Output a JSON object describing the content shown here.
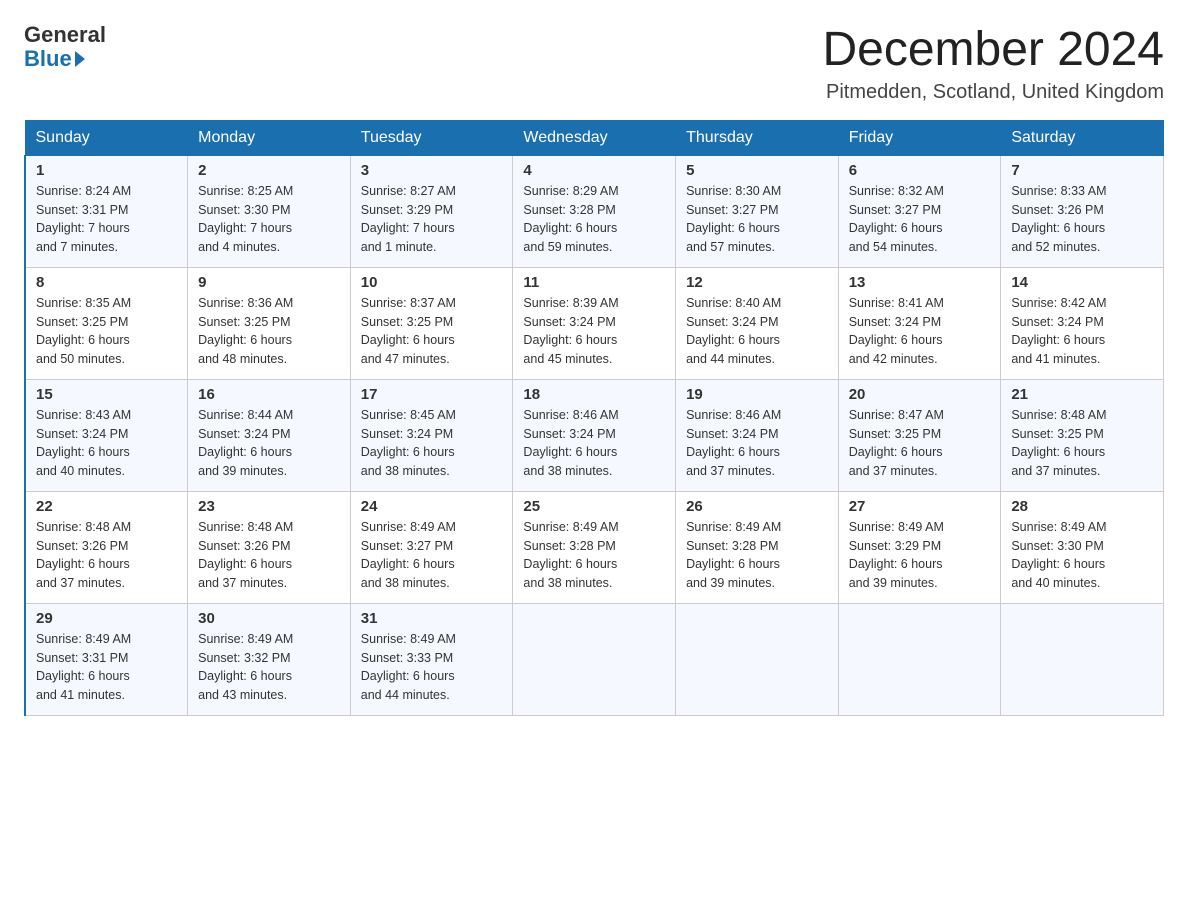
{
  "logo": {
    "general": "General",
    "blue": "Blue"
  },
  "title": "December 2024",
  "location": "Pitmedden, Scotland, United Kingdom",
  "days_of_week": [
    "Sunday",
    "Monday",
    "Tuesday",
    "Wednesday",
    "Thursday",
    "Friday",
    "Saturday"
  ],
  "weeks": [
    [
      {
        "day": "1",
        "info": "Sunrise: 8:24 AM\nSunset: 3:31 PM\nDaylight: 7 hours\nand 7 minutes."
      },
      {
        "day": "2",
        "info": "Sunrise: 8:25 AM\nSunset: 3:30 PM\nDaylight: 7 hours\nand 4 minutes."
      },
      {
        "day": "3",
        "info": "Sunrise: 8:27 AM\nSunset: 3:29 PM\nDaylight: 7 hours\nand 1 minute."
      },
      {
        "day": "4",
        "info": "Sunrise: 8:29 AM\nSunset: 3:28 PM\nDaylight: 6 hours\nand 59 minutes."
      },
      {
        "day": "5",
        "info": "Sunrise: 8:30 AM\nSunset: 3:27 PM\nDaylight: 6 hours\nand 57 minutes."
      },
      {
        "day": "6",
        "info": "Sunrise: 8:32 AM\nSunset: 3:27 PM\nDaylight: 6 hours\nand 54 minutes."
      },
      {
        "day": "7",
        "info": "Sunrise: 8:33 AM\nSunset: 3:26 PM\nDaylight: 6 hours\nand 52 minutes."
      }
    ],
    [
      {
        "day": "8",
        "info": "Sunrise: 8:35 AM\nSunset: 3:25 PM\nDaylight: 6 hours\nand 50 minutes."
      },
      {
        "day": "9",
        "info": "Sunrise: 8:36 AM\nSunset: 3:25 PM\nDaylight: 6 hours\nand 48 minutes."
      },
      {
        "day": "10",
        "info": "Sunrise: 8:37 AM\nSunset: 3:25 PM\nDaylight: 6 hours\nand 47 minutes."
      },
      {
        "day": "11",
        "info": "Sunrise: 8:39 AM\nSunset: 3:24 PM\nDaylight: 6 hours\nand 45 minutes."
      },
      {
        "day": "12",
        "info": "Sunrise: 8:40 AM\nSunset: 3:24 PM\nDaylight: 6 hours\nand 44 minutes."
      },
      {
        "day": "13",
        "info": "Sunrise: 8:41 AM\nSunset: 3:24 PM\nDaylight: 6 hours\nand 42 minutes."
      },
      {
        "day": "14",
        "info": "Sunrise: 8:42 AM\nSunset: 3:24 PM\nDaylight: 6 hours\nand 41 minutes."
      }
    ],
    [
      {
        "day": "15",
        "info": "Sunrise: 8:43 AM\nSunset: 3:24 PM\nDaylight: 6 hours\nand 40 minutes."
      },
      {
        "day": "16",
        "info": "Sunrise: 8:44 AM\nSunset: 3:24 PM\nDaylight: 6 hours\nand 39 minutes."
      },
      {
        "day": "17",
        "info": "Sunrise: 8:45 AM\nSunset: 3:24 PM\nDaylight: 6 hours\nand 38 minutes."
      },
      {
        "day": "18",
        "info": "Sunrise: 8:46 AM\nSunset: 3:24 PM\nDaylight: 6 hours\nand 38 minutes."
      },
      {
        "day": "19",
        "info": "Sunrise: 8:46 AM\nSunset: 3:24 PM\nDaylight: 6 hours\nand 37 minutes."
      },
      {
        "day": "20",
        "info": "Sunrise: 8:47 AM\nSunset: 3:25 PM\nDaylight: 6 hours\nand 37 minutes."
      },
      {
        "day": "21",
        "info": "Sunrise: 8:48 AM\nSunset: 3:25 PM\nDaylight: 6 hours\nand 37 minutes."
      }
    ],
    [
      {
        "day": "22",
        "info": "Sunrise: 8:48 AM\nSunset: 3:26 PM\nDaylight: 6 hours\nand 37 minutes."
      },
      {
        "day": "23",
        "info": "Sunrise: 8:48 AM\nSunset: 3:26 PM\nDaylight: 6 hours\nand 37 minutes."
      },
      {
        "day": "24",
        "info": "Sunrise: 8:49 AM\nSunset: 3:27 PM\nDaylight: 6 hours\nand 38 minutes."
      },
      {
        "day": "25",
        "info": "Sunrise: 8:49 AM\nSunset: 3:28 PM\nDaylight: 6 hours\nand 38 minutes."
      },
      {
        "day": "26",
        "info": "Sunrise: 8:49 AM\nSunset: 3:28 PM\nDaylight: 6 hours\nand 39 minutes."
      },
      {
        "day": "27",
        "info": "Sunrise: 8:49 AM\nSunset: 3:29 PM\nDaylight: 6 hours\nand 39 minutes."
      },
      {
        "day": "28",
        "info": "Sunrise: 8:49 AM\nSunset: 3:30 PM\nDaylight: 6 hours\nand 40 minutes."
      }
    ],
    [
      {
        "day": "29",
        "info": "Sunrise: 8:49 AM\nSunset: 3:31 PM\nDaylight: 6 hours\nand 41 minutes."
      },
      {
        "day": "30",
        "info": "Sunrise: 8:49 AM\nSunset: 3:32 PM\nDaylight: 6 hours\nand 43 minutes."
      },
      {
        "day": "31",
        "info": "Sunrise: 8:49 AM\nSunset: 3:33 PM\nDaylight: 6 hours\nand 44 minutes."
      },
      {
        "day": "",
        "info": ""
      },
      {
        "day": "",
        "info": ""
      },
      {
        "day": "",
        "info": ""
      },
      {
        "day": "",
        "info": ""
      }
    ]
  ]
}
